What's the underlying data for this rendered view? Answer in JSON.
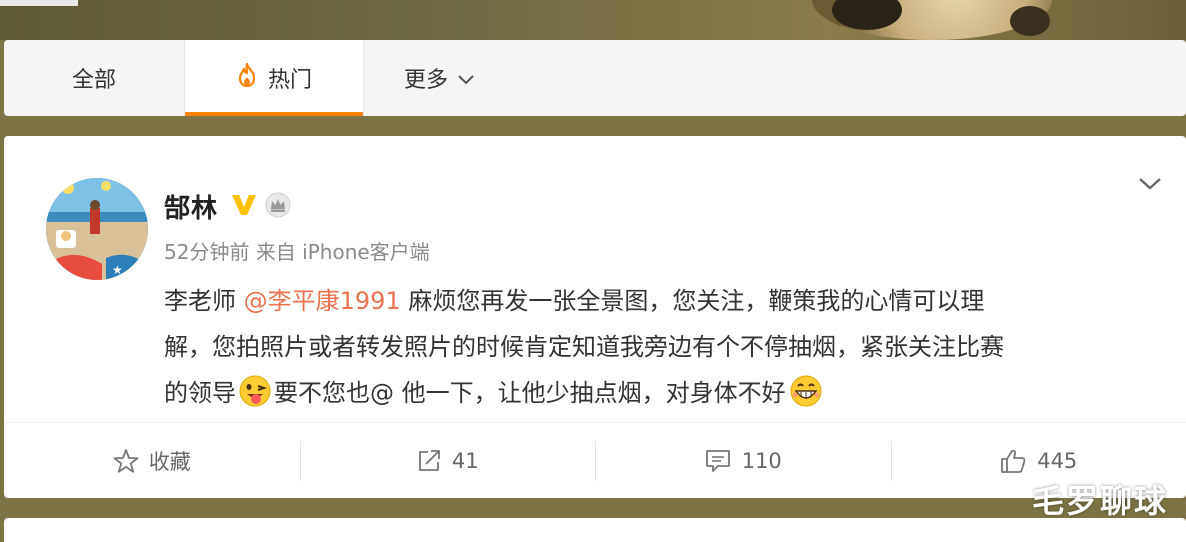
{
  "tabs": {
    "all": "全部",
    "hot": "热门",
    "more": "更多"
  },
  "post": {
    "author": "郜林",
    "time": "52分钟前",
    "source": "来自 iPhone客户端",
    "content": {
      "part1": "李老师 ",
      "mention": "@李平康1991",
      "part2": " 麻烦您再发一张全景图，您关注，鞭策我的心情可以理",
      "line2": "解，您拍照片或者转发照片的时候肯定知道我旁边有个不停抽烟，紧张关注比赛",
      "line3a": "的领导",
      "line3b": "要不您也@ 他一下，让他少抽点烟，对身体不好"
    }
  },
  "actions": {
    "favorite": "收藏",
    "repost": "41",
    "comment": "110",
    "like": "445"
  },
  "watermark": "毛罗聊球",
  "colors": {
    "accent": "#ff8200",
    "mention": "#eb7350",
    "vbadge": "#ffc100"
  }
}
